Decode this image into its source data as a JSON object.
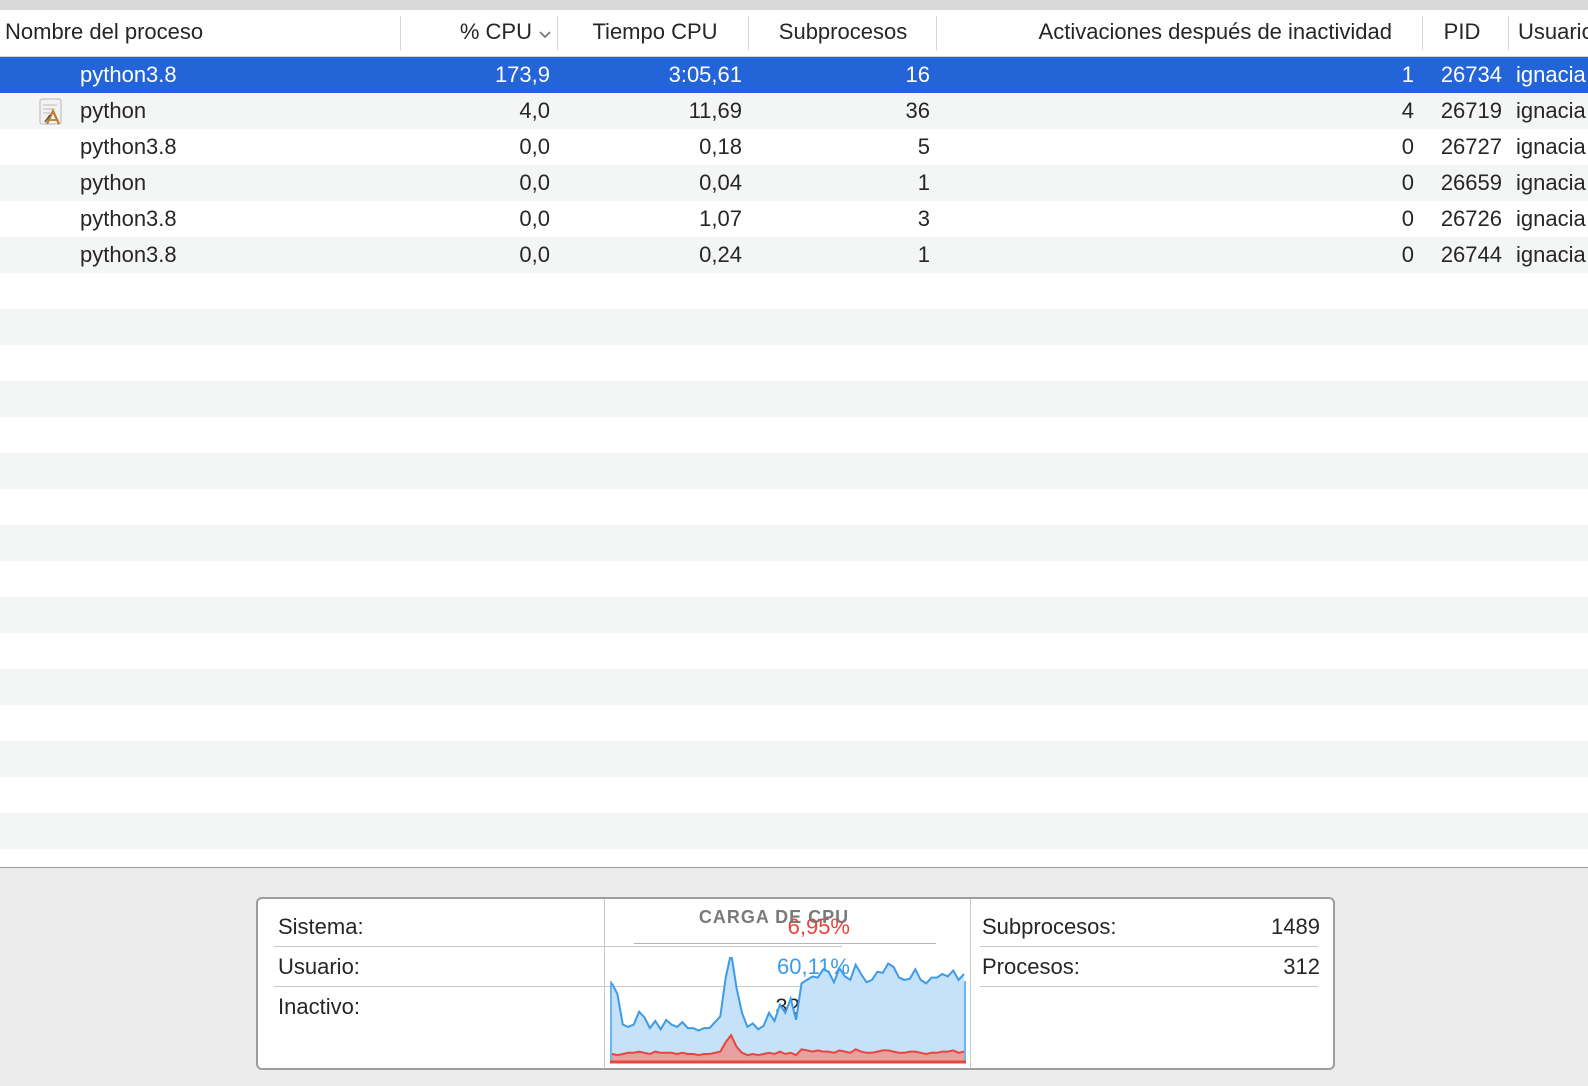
{
  "columns": {
    "name": "Nombre del proceso",
    "cpu": "% CPU",
    "cpu_time": "Tiempo CPU",
    "threads": "Subprocesos",
    "wakeups": "Activaciones después de inactividad",
    "pid": "PID",
    "user": "Usuario"
  },
  "sort": {
    "column": "cpu",
    "direction": "descending",
    "icon": "chevron-down-icon"
  },
  "rows": [
    {
      "name": "python3.8",
      "cpu": "173,9",
      "cpu_time": "3:05,61",
      "threads": "16",
      "wakeups": "1",
      "pid": "26734",
      "user": "ignacia",
      "selected": true,
      "icon": ""
    },
    {
      "name": "python",
      "cpu": "4,0",
      "cpu_time": "11,69",
      "threads": "36",
      "wakeups": "4",
      "pid": "26719",
      "user": "ignacia",
      "selected": false,
      "icon": "python-launcher-icon"
    },
    {
      "name": "python3.8",
      "cpu": "0,0",
      "cpu_time": "0,18",
      "threads": "5",
      "wakeups": "0",
      "pid": "26727",
      "user": "ignacia",
      "selected": false,
      "icon": ""
    },
    {
      "name": "python",
      "cpu": "0,0",
      "cpu_time": "0,04",
      "threads": "1",
      "wakeups": "0",
      "pid": "26659",
      "user": "ignacia",
      "selected": false,
      "icon": ""
    },
    {
      "name": "python3.8",
      "cpu": "0,0",
      "cpu_time": "1,07",
      "threads": "3",
      "wakeups": "0",
      "pid": "26726",
      "user": "ignacia",
      "selected": false,
      "icon": ""
    },
    {
      "name": "python3.8",
      "cpu": "0,0",
      "cpu_time": "0,24",
      "threads": "1",
      "wakeups": "0",
      "pid": "26744",
      "user": "ignacia",
      "selected": false,
      "icon": ""
    }
  ],
  "summary": {
    "system_label": "Sistema:",
    "system_value": "6,95%",
    "user_label": "Usuario:",
    "user_value": "60,11%",
    "idle_label": "Inactivo:",
    "idle_value": "32,94%",
    "graph_title": "CARGA DE CPU",
    "threads_label": "Subprocesos:",
    "threads_value": "1489",
    "processes_label": "Procesos:",
    "processes_value": "312"
  },
  "colors": {
    "selection": "#2364d9",
    "system": "#e8463c",
    "user": "#3d9be9",
    "user_fill": "#c6e2f8",
    "system_fill": "#e8a0a0"
  },
  "cpu_load_history": {
    "user_percent": [
      60,
      52,
      25,
      22,
      24,
      34,
      30,
      22,
      26,
      20,
      28,
      24,
      23,
      26,
      22,
      22,
      21,
      22,
      22,
      26,
      30,
      55,
      70,
      50,
      34,
      24,
      26,
      22,
      24,
      34,
      28,
      40,
      35,
      46,
      30,
      56,
      60,
      64,
      62,
      70,
      68,
      60,
      70,
      64,
      62,
      72,
      66,
      60,
      62,
      68,
      66,
      74,
      72,
      64,
      62,
      62,
      70,
      62,
      60,
      64,
      64,
      66,
      64,
      68,
      62,
      66
    ],
    "system_percent": [
      6,
      5,
      6,
      7,
      7,
      8,
      7,
      6,
      8,
      7,
      7,
      7,
      6,
      7,
      6,
      6,
      5,
      6,
      6,
      7,
      8,
      16,
      22,
      12,
      7,
      5,
      6,
      5,
      6,
      7,
      6,
      8,
      6,
      7,
      5,
      10,
      9,
      8,
      9,
      8,
      8,
      7,
      9,
      8,
      7,
      10,
      8,
      7,
      7,
      8,
      9,
      9,
      8,
      7,
      7,
      8,
      8,
      7,
      6,
      7,
      7,
      8,
      8,
      9,
      7,
      8
    ]
  }
}
